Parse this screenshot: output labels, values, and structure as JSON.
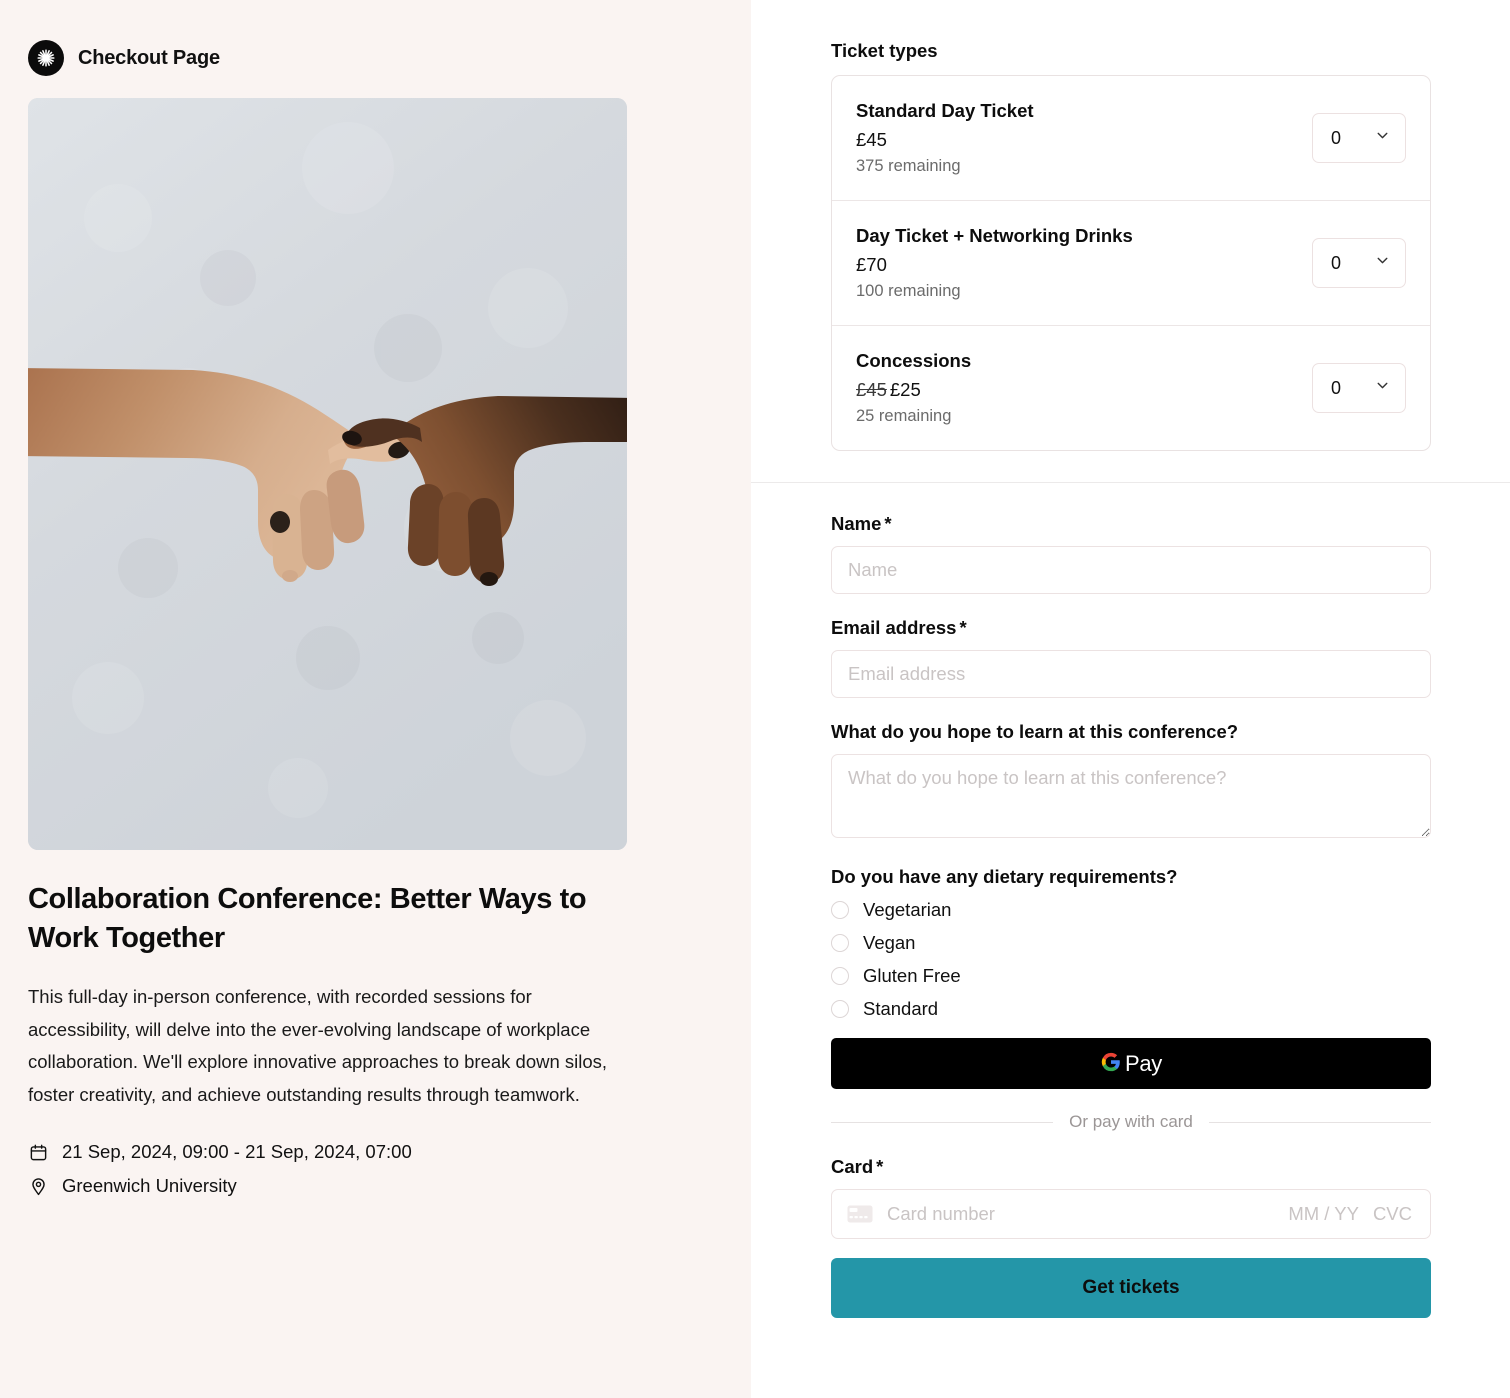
{
  "brand": {
    "title": "Checkout Page",
    "logo_icon": "asterisk-logo-icon"
  },
  "event": {
    "title": "Collaboration Conference: Better Ways to Work Together",
    "description": "This full-day in-person conference, with recorded sessions for accessibility, will delve into the ever-evolving landscape of workplace collaboration. We'll explore innovative approaches to break down silos, foster creativity, and achieve outstanding results through teamwork.",
    "date": "21 Sep, 2024, 09:00 - 21 Sep, 2024, 07:00",
    "location": "Greenwich University",
    "date_icon": "calendar-icon",
    "location_icon": "map-pin-icon",
    "image_alt": "two-hands-reaching-toward-each-other"
  },
  "tickets": {
    "heading": "Ticket types",
    "items": [
      {
        "name": "Standard Day Ticket",
        "price": "£45",
        "old_price": "",
        "remaining": "375 remaining",
        "quantity": "0"
      },
      {
        "name": "Day Ticket + Networking Drinks",
        "price": "£70",
        "old_price": "",
        "remaining": "100 remaining",
        "quantity": "0"
      },
      {
        "name": "Concessions",
        "price": "£25",
        "old_price": "£45",
        "remaining": "25 remaining",
        "quantity": "0"
      }
    ]
  },
  "form": {
    "name": {
      "label": "Name",
      "required_mark": "*",
      "value": "",
      "placeholder": "Name"
    },
    "email": {
      "label": "Email address",
      "required_mark": "*",
      "value": "",
      "placeholder": "Email address"
    },
    "learn": {
      "label": "What do you hope to learn at this conference?",
      "value": "",
      "placeholder": "What do you hope to learn at this conference?"
    },
    "dietary": {
      "label": "Do you have any dietary requirements?",
      "options": [
        {
          "label": "Vegetarian",
          "selected": false
        },
        {
          "label": "Vegan",
          "selected": false
        },
        {
          "label": "Gluten Free",
          "selected": false
        },
        {
          "label": "Standard",
          "selected": false
        }
      ]
    }
  },
  "payment": {
    "gpay_label": "Pay",
    "gpay_icon": "google-g-icon",
    "or_text": "Or pay with card",
    "card_label": "Card",
    "card_required_mark": "*",
    "card_icon": "credit-card-icon",
    "card_number_placeholder": "Card number",
    "card_expiry_placeholder": "MM / YY",
    "card_cvc_placeholder": "CVC",
    "submit_label": "Get tickets"
  },
  "colors": {
    "left_panel_bg": "#faf4f2",
    "accent_teal": "#2496a8",
    "gpay_bg": "#000000",
    "border": "#ece2e2"
  }
}
